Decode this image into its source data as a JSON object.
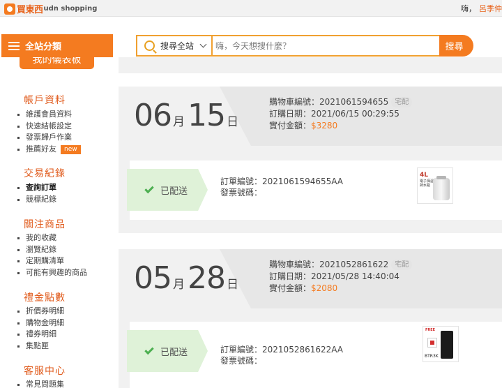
{
  "header": {
    "logo_cn": "買東西",
    "logo_en": "udn shopping",
    "greeting": "嗨，",
    "username": "呂季仲"
  },
  "category": {
    "label": "全站分類"
  },
  "search": {
    "scope": "搜尋全站",
    "placeholder": "嗨，今天想搜什麼？",
    "button": "搜尋"
  },
  "sidebar": {
    "dashboard": "我的儀表板",
    "sections": [
      {
        "title": "帳戶資料",
        "items": [
          {
            "label": "維護會員資料"
          },
          {
            "label": "快速結帳設定"
          },
          {
            "label": "發票歸戶作業"
          },
          {
            "label": "推薦好友",
            "badge": "new"
          }
        ]
      },
      {
        "title": "交易紀錄",
        "items": [
          {
            "label": "查詢訂單",
            "active": true
          },
          {
            "label": "競標紀錄"
          }
        ]
      },
      {
        "title": "關注商品",
        "items": [
          {
            "label": "我的收藏"
          },
          {
            "label": "瀏覽紀錄"
          },
          {
            "label": "定期購清單"
          },
          {
            "label": "可能有興趣的商品"
          }
        ]
      },
      {
        "title": "禮金點數",
        "items": [
          {
            "label": "折價券明細"
          },
          {
            "label": "購物金明細"
          },
          {
            "label": "禮券明細"
          },
          {
            "label": "集點匣"
          }
        ]
      },
      {
        "title": "客服中心",
        "items": [
          {
            "label": "常見問題集"
          }
        ]
      }
    ]
  },
  "orders": [
    {
      "month": "06",
      "month_unit": "月",
      "day": "15",
      "day_unit": "日",
      "cart_label": "購物車編號：",
      "cart_no": "2021061594655",
      "delivery": "宅配",
      "date_label": "訂購日期：",
      "date": "2021/06/15 00:29:55",
      "amount_label": "實付金額：",
      "amount": "$3280",
      "status": "已配送",
      "order_label": "訂單編號：",
      "order_no": "2021061594655AA",
      "invoice_label": "發票號碼：",
      "invoice_no": "",
      "product": {
        "icon": "water-dispenser-icon",
        "text1": "4L",
        "text2": "電子保溫熱水瓶"
      }
    },
    {
      "month": "05",
      "month_unit": "月",
      "day": "28",
      "day_unit": "日",
      "cart_label": "購物車編號：",
      "cart_no": "2021052861622",
      "delivery": "宅配",
      "date_label": "訂購日期：",
      "date": "2021/05/28 14:40:04",
      "amount_label": "實付金額：",
      "amount": "$2080",
      "status": "已配送",
      "order_label": "訂單編號：",
      "order_no": "2021052861622AA",
      "invoice_label": "發票號碼：",
      "invoice_no": "",
      "product": {
        "icon": "router-icon",
        "text1": "BTR3K",
        "text2": "FREE"
      }
    }
  ],
  "colors": {
    "brand": "#f47b20",
    "accent_text": "#e05a1b",
    "status_bg": "#dff2d8",
    "check": "#4caf50"
  }
}
